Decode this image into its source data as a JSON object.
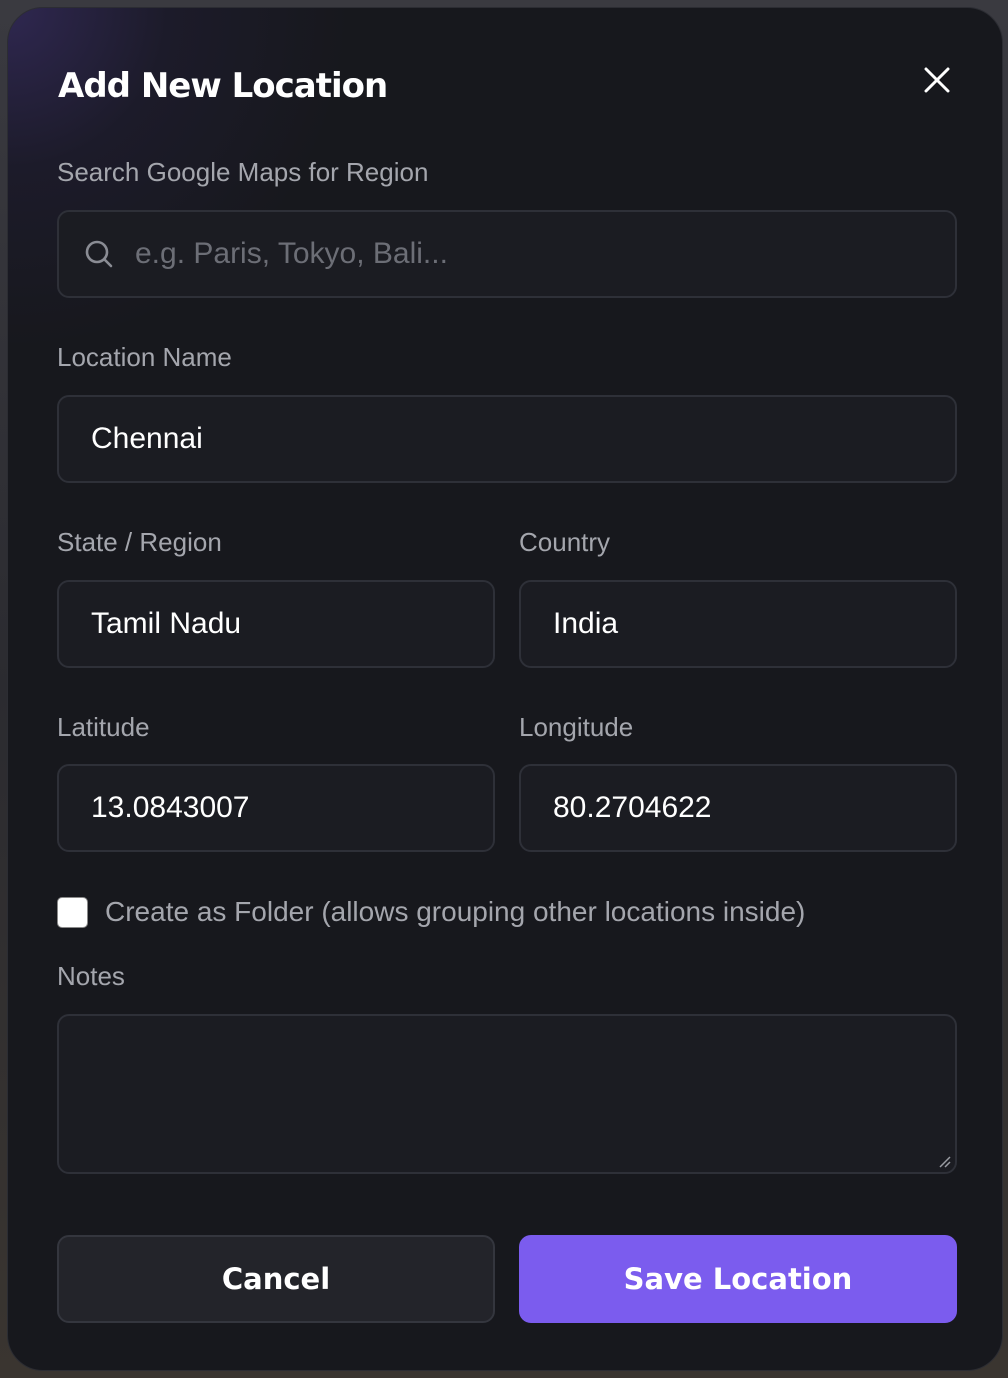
{
  "dialog": {
    "title": "Add New Location"
  },
  "search": {
    "label": "Search Google Maps for Region",
    "placeholder": "e.g. Paris, Tokyo, Bali...",
    "value": "",
    "icon": "search-icon"
  },
  "location_name": {
    "label": "Location Name",
    "value": "Chennai"
  },
  "state_region": {
    "label": "State / Region",
    "value": "Tamil Nadu"
  },
  "country": {
    "label": "Country",
    "value": "India"
  },
  "latitude": {
    "label": "Latitude",
    "value": "13.0843007"
  },
  "longitude": {
    "label": "Longitude",
    "value": "80.2704622"
  },
  "folder_option": {
    "label": "Create as Folder (allows grouping other locations inside)",
    "checked": false
  },
  "notes": {
    "label": "Notes",
    "value": ""
  },
  "actions": {
    "cancel_label": "Cancel",
    "save_label": "Save Location"
  },
  "colors": {
    "accent": "#7b5cee",
    "background": "#17181d",
    "field_background": "#1b1c22",
    "label_text": "#a4a6ad"
  }
}
